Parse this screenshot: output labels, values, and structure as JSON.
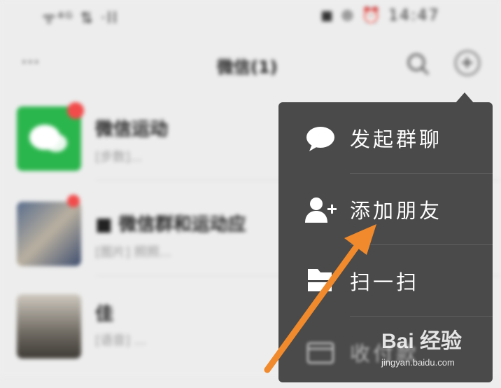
{
  "status_bar": {
    "left": "ᯤ⁴ᴳ ⇅ ·ll",
    "right": "◼ ⊛ ⏰ 14:47"
  },
  "nav": {
    "more": "···",
    "title": "微信(1)"
  },
  "chats": [
    {
      "name": "微信运动",
      "preview": "[步数]...",
      "avatar_color": "#2bb64d"
    },
    {
      "name": "■ 微信群和运动应",
      "preview": "[图片] 照照...",
      "avatar_color": "#6c7f9e"
    },
    {
      "name": "佳",
      "preview": "[语音] ...",
      "avatar_color": "#8c857a"
    }
  ],
  "menu": {
    "items": [
      {
        "label": "发起群聊",
        "icon": "chat-bubble-icon"
      },
      {
        "label": "添加朋友",
        "icon": "add-friend-icon"
      },
      {
        "label": "扫一扫",
        "icon": "scan-icon"
      },
      {
        "label": "收付款",
        "icon": "payment-icon"
      }
    ]
  },
  "watermark": {
    "brand": "Bai 经验",
    "url": "jingyan.baidu.com"
  },
  "colors": {
    "menu_bg": "#4a4a4a",
    "arrow": "#f08a2c",
    "wechat_green": "#2bb64d"
  }
}
